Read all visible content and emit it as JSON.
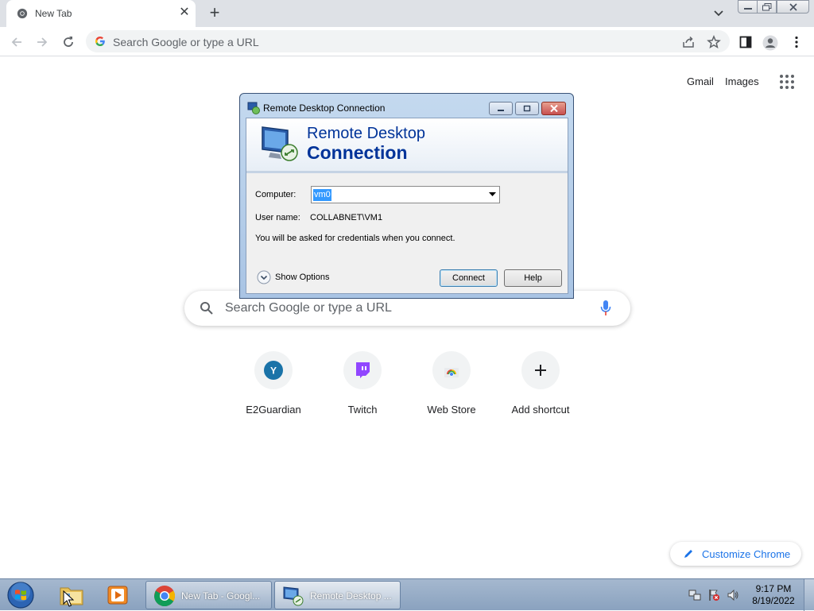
{
  "browser": {
    "tab": {
      "title": "New Tab",
      "favicon": "chrome-icon"
    },
    "omnibox": {
      "placeholder": "Search Google or type a URL"
    },
    "toolbar_icons": [
      "back-icon",
      "forward-icon",
      "reload-icon",
      "share-icon",
      "bookmark-star-icon",
      "side-panel-icon",
      "profile-icon",
      "menu-icon"
    ]
  },
  "ntp": {
    "top_links": {
      "gmail": "Gmail",
      "images": "Images"
    },
    "search_placeholder": "Search Google or type a URL",
    "shortcuts": [
      {
        "label": "E2Guardian",
        "icon_letter": "Y",
        "icon_color": "#1a73a8"
      },
      {
        "label": "Twitch",
        "icon": "twitch-icon",
        "icon_color": "#9146ff"
      },
      {
        "label": "Web Store",
        "icon": "web-store-icon"
      },
      {
        "label": "Add shortcut",
        "icon": "plus-icon"
      }
    ],
    "customize_label": "Customize Chrome"
  },
  "rdp_dialog": {
    "title": "Remote Desktop Connection",
    "heading_line1": "Remote Desktop",
    "heading_line2": "Connection",
    "computer_label": "Computer:",
    "computer_value": "vm0",
    "username_label": "User name:",
    "username_value": "COLLABNET\\VM1",
    "credentials_note": "You will be asked for credentials when you connect.",
    "show_options": "Show Options",
    "connect_label": "Connect",
    "help_label": "Help",
    "accent_color": "#003399"
  },
  "taskbar": {
    "tasks": [
      {
        "label": "New Tab - Googl...",
        "icon": "chrome-icon"
      },
      {
        "label": "Remote Desktop ...",
        "icon": "remote-desktop-icon"
      }
    ],
    "clock_time": "9:17 PM",
    "clock_date": "8/19/2022"
  }
}
